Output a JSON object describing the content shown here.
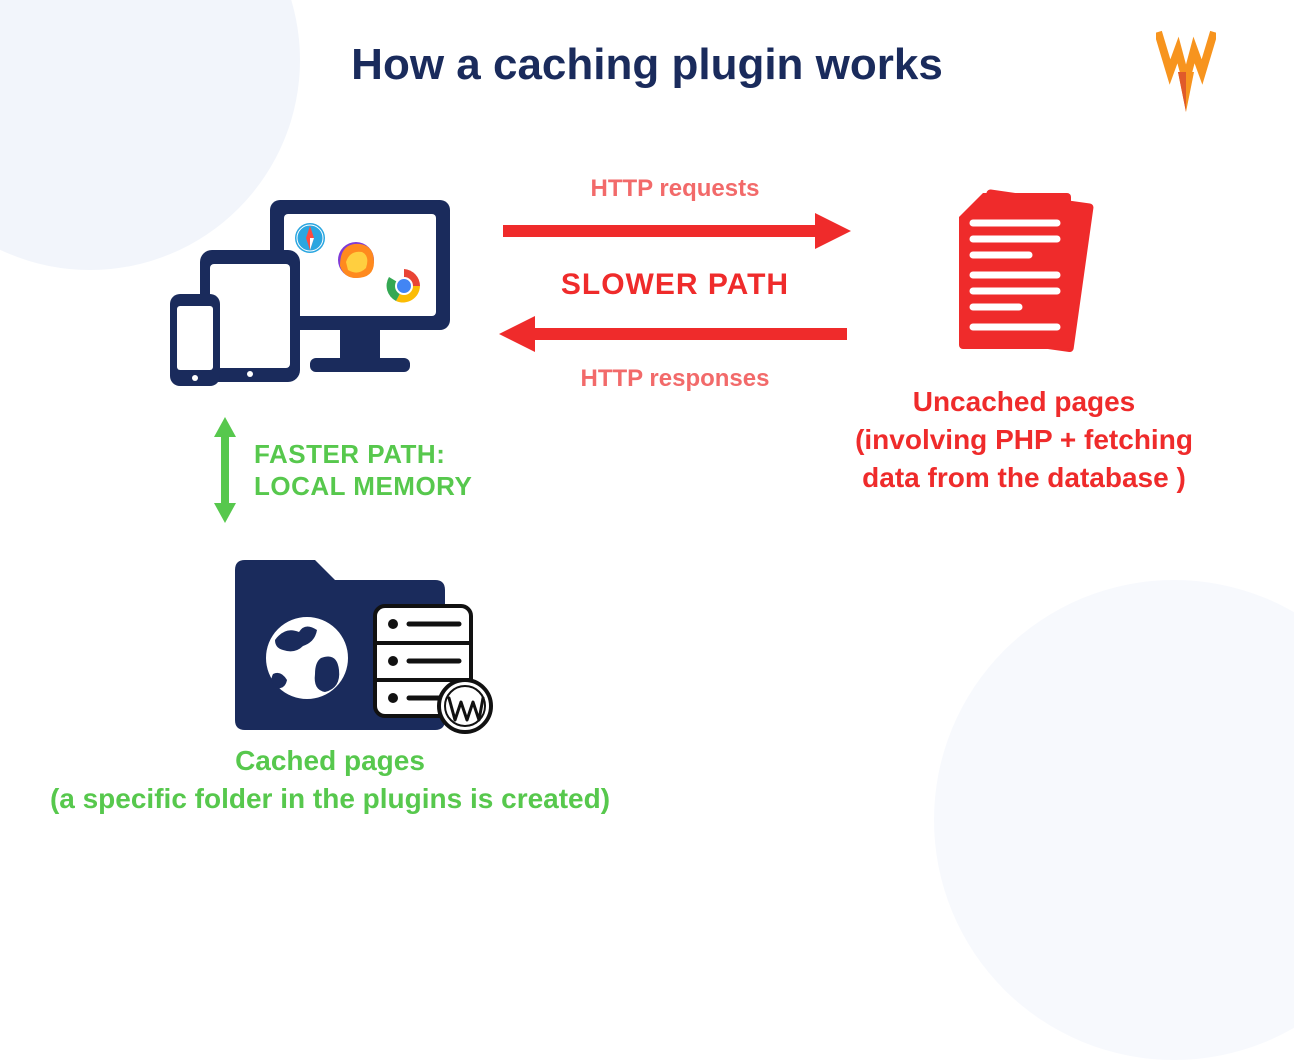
{
  "title": "How a caching plugin works",
  "flow": {
    "requests_label": "HTTP requests",
    "slower_path_label": "SLOWER PATH",
    "responses_label": "HTTP responses"
  },
  "uncached": {
    "heading": "Uncached pages",
    "subtext": "(involving PHP + fetching data from the database )"
  },
  "faster_path": {
    "line1": "FASTER PATH:",
    "line2": "LOCAL MEMORY"
  },
  "cached": {
    "heading": "Cached pages",
    "subtext": "(a specific folder in the plugins is created)"
  },
  "colors": {
    "navy": "#1a2b5c",
    "red": "#ef2b2b",
    "red_soft": "#f26a6a",
    "green": "#57c84d",
    "orange": "#f7941e"
  }
}
